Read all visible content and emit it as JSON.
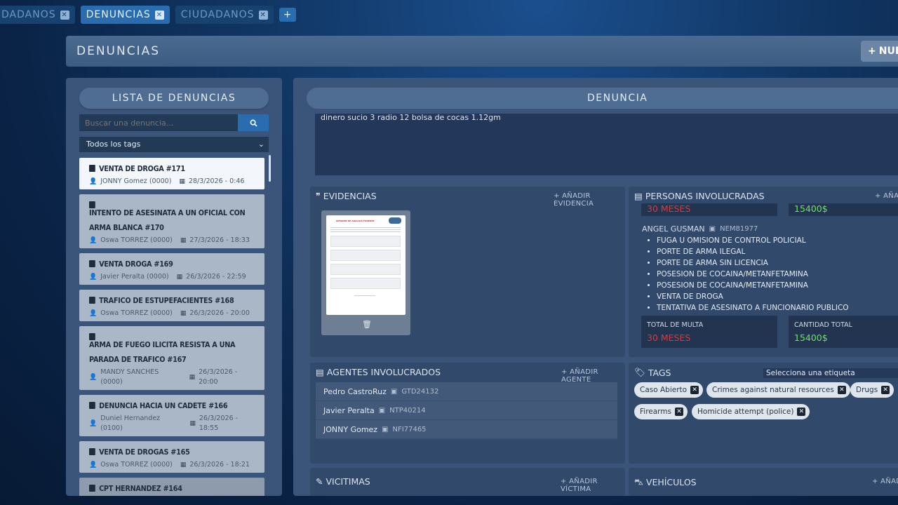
{
  "tabs": [
    {
      "label": "DADANOS"
    },
    {
      "label": "DENUNCIAS"
    },
    {
      "label": "CIUDADANOS"
    }
  ],
  "tab_add": "+",
  "header": {
    "title": "DENUNCIAS",
    "new_button": "NUEV"
  },
  "list_panel": {
    "title": "LISTA DE DENUNCIAS",
    "search_placeholder": "Buscar una denuncia...",
    "tag_filter": "Todos los tags",
    "items": [
      {
        "title": "VENTA DE DROGA #171",
        "person": "JONNY Gomez (0000)",
        "date": "28/3/2026 - 0:46"
      },
      {
        "title": "INTENTO DE ASESINATA A UN OFICIAL CON ARMA BLANCA #170",
        "person": "Oswa TORREZ (0000)",
        "date": "27/3/2026 - 18:33"
      },
      {
        "title": "VENTA DROGA #169",
        "person": "Javier Peralta (0000)",
        "date": "26/3/2026 - 22:59"
      },
      {
        "title": "TRAFICO DE ESTUPEFACIENTES #168",
        "person": "Oswa TORREZ (0000)",
        "date": "26/3/2026 - 20:00"
      },
      {
        "title": "ARMA DE FUEGO ILICITA RESISTA A UNA PARADA DE TRAFICO #167",
        "person": "MANDY SANCHES (0000)",
        "date": "26/3/2026 - 20:00"
      },
      {
        "title": "DENUNCIA HACIA UN CADETE #166",
        "person": "Duniel Hernandez (0100)",
        "date": "26/3/2026 - 18:55"
      },
      {
        "title": "VENTA DE DROGAS #165",
        "person": "Oswa TORREZ (0000)",
        "date": "26/3/2026 - 18:21"
      },
      {
        "title": "CPT HERNANDEZ #164",
        "person": "",
        "date": ""
      }
    ]
  },
  "detail": {
    "title": "DENUNCIA",
    "description": "dinero sucio 3 radio 12 bolsa de cocas 1.12gm",
    "evidence": {
      "title": "EVIDENCIAS",
      "add": "+ AÑADIR EVIDENCIA",
      "doc_heading": "INFORME DE ANÁLISIS FORENSE"
    },
    "persons": {
      "title": "PERSONAS INVOLUCRADAS",
      "add": "+ AÑAD",
      "prev_fine": "30 MESES",
      "prev_total": "15400$",
      "person_name": "ANGEL GUSMAN",
      "person_id": "NEM81977",
      "charges": [
        "FUGA U OMISION DE CONTROL POLICIAL",
        "PORTE DE ARMA ILEGAL",
        "PORTE DE ARMA SIN LICENCIA",
        "POSESION DE COCAINA/METANFETAMINA",
        "POSESION DE COCAINA/METANFETAMINA",
        "VENTA DE DROGA",
        "TENTATIVA DE ASESINATO A FUNCIONARIO PUBLICO"
      ],
      "fine_label": "TOTAL DE MULTA",
      "fine_value": "30 MESES",
      "total_label": "CANTIDAD TOTAL",
      "total_value": "15400$"
    },
    "agents": {
      "title": "AGENTES INVOLUCRADOS",
      "add": "+ AÑADIR AGENTE",
      "list": [
        {
          "name": "Pedro CastroRuz",
          "id": "GTD24132"
        },
        {
          "name": "Javier Peralta",
          "id": "NTP40214"
        },
        {
          "name": "JONNY Gomez",
          "id": "NFI77465"
        }
      ]
    },
    "tags": {
      "title": "TAGS",
      "select": "Selecciona una etiqueta",
      "list": [
        "Caso Abierto",
        "Crimes against natural resources",
        "Drugs",
        "Firearms",
        "Homicide attempt (police)"
      ]
    },
    "victims": {
      "title": "VICITIMAS",
      "add": "+ AÑADIR VÍCTIMA"
    },
    "vehicles": {
      "title": "VEHÍCULOS",
      "add": "+ AÑAD"
    }
  }
}
